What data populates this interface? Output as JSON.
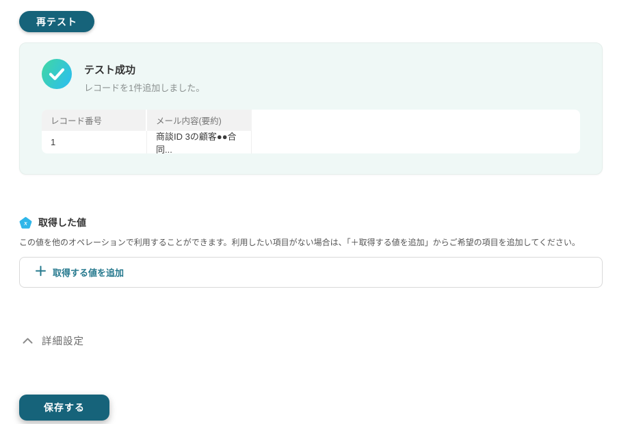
{
  "actions": {
    "retest_label": "再テスト",
    "save_label": "保存する"
  },
  "test_result": {
    "title": "テスト成功",
    "message": "レコードを1件追加しました。",
    "table": {
      "columns": [
        "レコード番号",
        "メール内容(要約)"
      ],
      "rows": [
        [
          "1",
          "商談ID 3の顧客●●合同..."
        ]
      ]
    }
  },
  "retrieved_values": {
    "title": "取得した値",
    "description": "この値を他のオペレーションで利用することができます。利用したい項目がない場合は、「＋取得する値を追加」からご希望の項目を追加してください。",
    "add_label": "取得する値を追加"
  },
  "advanced": {
    "label": "詳細設定"
  },
  "icons": {
    "success": "check-circle",
    "variable": "pentagon-x",
    "add": "plus",
    "advanced": "chevron-up"
  },
  "colors": {
    "accent_teal": "#16637a",
    "link_teal": "#26798e",
    "panel_background": "#eff8f6",
    "success_gradient_start": "#41d7a2",
    "success_gradient_end": "#2ec1e6",
    "variable_icon_blue": "#2fb6e9",
    "table_header_gray": "#f2f2f2"
  }
}
